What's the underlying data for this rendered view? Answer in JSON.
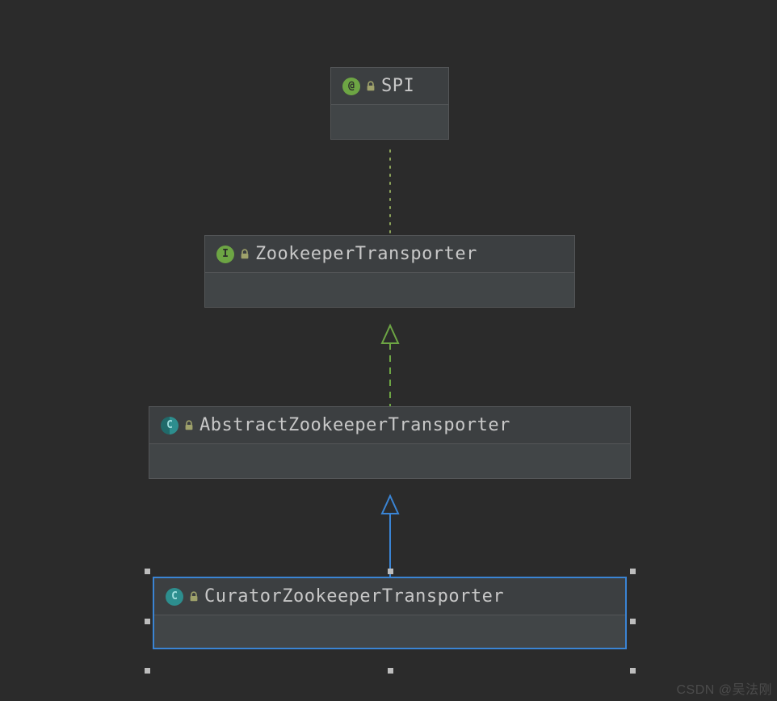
{
  "nodes": {
    "spi": {
      "label": "SPI",
      "kind_letter": "@",
      "kind_type": "annotation"
    },
    "transporter": {
      "label": "ZookeeperTransporter",
      "kind_letter": "I",
      "kind_type": "interface"
    },
    "abstract_transporter": {
      "label": "AbstractZookeeperTransporter",
      "kind_letter": "C",
      "kind_type": "abstract-class"
    },
    "curator_transporter": {
      "label": "CuratorZookeeperTransporter",
      "kind_letter": "C",
      "kind_type": "class"
    }
  },
  "edges": [
    {
      "from": "spi",
      "to": "transporter",
      "style": "dotted",
      "arrow": "none",
      "color": "#8da45a"
    },
    {
      "from": "transporter",
      "to": "abstract_transporter",
      "style": "dashed",
      "arrow": "hollow-triangle",
      "color": "#6da544"
    },
    {
      "from": "abstract_transporter",
      "to": "curator_transporter",
      "style": "solid",
      "arrow": "hollow-triangle",
      "color": "#3a84d4"
    }
  ],
  "selection": "curator_transporter",
  "watermark": "CSDN @吴法刚",
  "colors": {
    "bg": "#2b2b2b",
    "node_bg": "#3c3f41",
    "border": "#545658",
    "selected_border": "#3a84d4",
    "green": "#6da544",
    "teal": "#2d8e8e"
  }
}
